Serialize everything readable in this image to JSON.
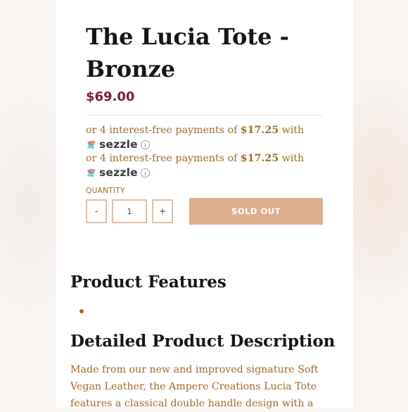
{
  "product": {
    "title": "The Lucia Tote - Bronze",
    "price": "$69.00"
  },
  "sezzle": {
    "prefix": "or 4 interest-free payments of",
    "amount": "$17.25",
    "suffix": "with",
    "brand": "sezzle",
    "repeat_count_shown": 2
  },
  "quantity": {
    "label": "QUANTITY",
    "minus_label": "-",
    "value": "1",
    "plus_label": "+"
  },
  "cart": {
    "button_label": "SOLD OUT"
  },
  "sections": {
    "features_title": "Product Features",
    "features_items": [
      ""
    ],
    "description_title": "Detailed Product Description",
    "description_text": "Made from our new and improved signature Soft Vegan Leather, the Ampere Creations Lucia Tote features a classical double handle design with a"
  },
  "colors": {
    "price": "#7a2034",
    "accent": "#a3692c",
    "button_bg": "#deb08f",
    "border": "#e0bfa4",
    "heading": "#151515"
  },
  "icons": {
    "sezzle_logo": "sezzle-logo-icon",
    "info": "info-icon"
  }
}
